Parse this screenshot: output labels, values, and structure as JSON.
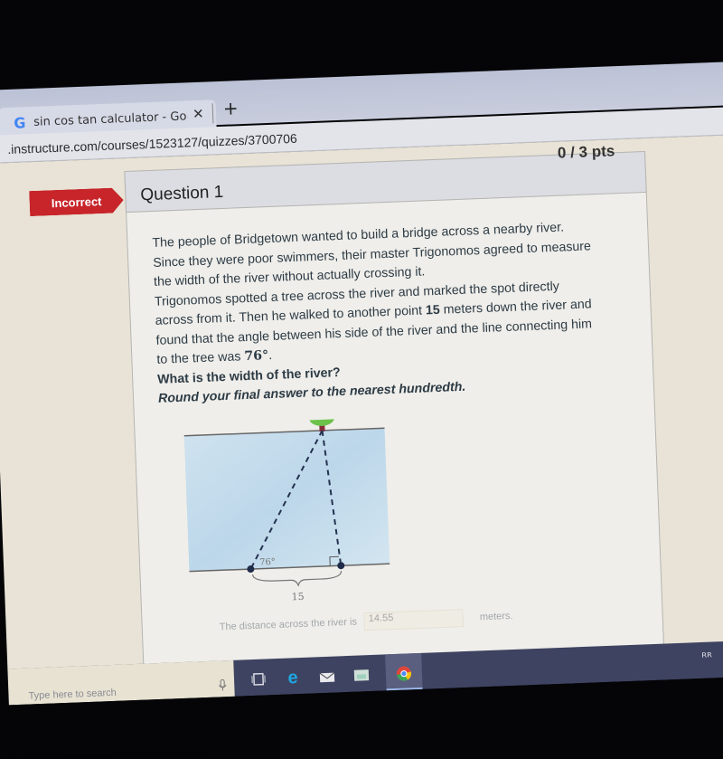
{
  "browser": {
    "tab": {
      "favicon": "google-g-icon",
      "title": "sin cos tan calculator - Google Se",
      "close_glyph": "✕"
    },
    "new_tab_glyph": "+",
    "address": ".instructure.com/courses/1523127/quizzes/3700706"
  },
  "quiz": {
    "status_badge": "Incorrect",
    "status_color": "#c7252a",
    "question_title": "Question 1",
    "points": "0 / 3 pts",
    "paragraph_lines": [
      "The people of Bridgetown wanted to build a bridge across a nearby river.",
      "Since they were poor swimmers, their master Trigonomos agreed to measure",
      "the width of the river without actually crossing it.",
      "Trigonomos spotted a tree across the river and marked the spot directly"
    ],
    "line5_pre": "across from it. Then he walked to another point ",
    "line5_bold": "15",
    "line5_post": " meters down the river and",
    "line6": "found that the angle between his side of the river and the line connecting him",
    "line7_pre": "to the tree was ",
    "line7_angle": "76°",
    "line7_post": ".",
    "question": "What is the width of the river?",
    "instruction": "Round your final answer to the nearest hundredth.",
    "diagram": {
      "angle_label": "76°",
      "base_label": "15",
      "tree_icon": "tree-icon"
    },
    "answer": {
      "prefix": "The distance across the river is",
      "value": "14.55",
      "unit": "meters."
    }
  },
  "taskbar": {
    "search_placeholder": "Type here to search",
    "apps": [
      "task-view",
      "edge",
      "mail",
      "file-explorer",
      "chrome"
    ],
    "tray": {
      "people_glyph": "ᴿᴿ",
      "chevron_glyph": "^"
    }
  }
}
